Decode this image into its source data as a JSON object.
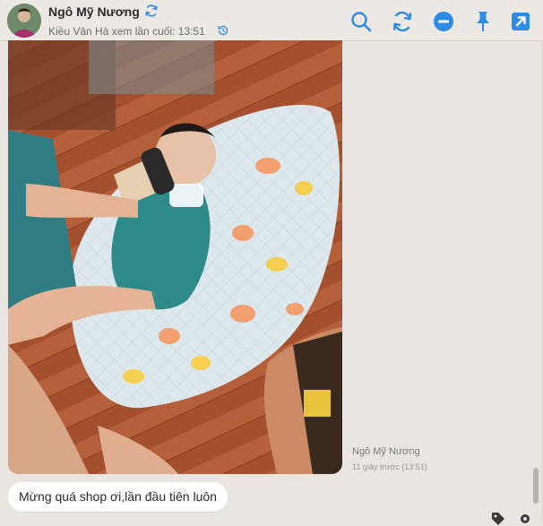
{
  "header": {
    "contact_name": "Ngô Mỹ Nương",
    "last_seen": "Kiều Vân Hà xem lần cuối: 13:51"
  },
  "toolbar": {
    "icons": [
      "search-icon",
      "refresh-icon",
      "minus-circle-icon",
      "pin-icon",
      "external-link-icon"
    ]
  },
  "message": {
    "sender": "Ngô Mỹ Nương",
    "time": "11 giây trước (13:51)",
    "text": "Mừng quá shop ơi,lần đầu tiên luôn"
  },
  "colors": {
    "accent": "#2e8be6",
    "background": "#e9e5e0"
  }
}
